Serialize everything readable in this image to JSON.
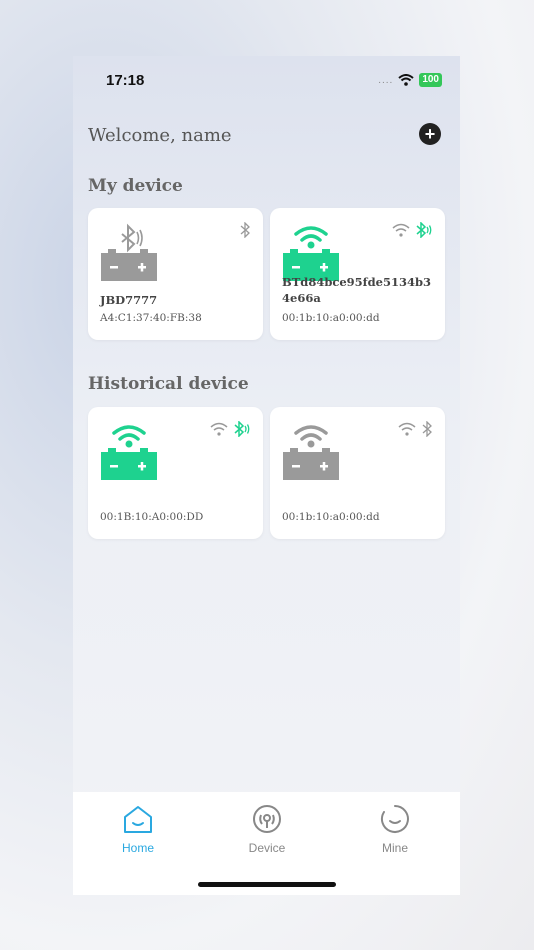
{
  "status_bar": {
    "time": "17:18",
    "signal": "....",
    "battery": "100"
  },
  "header": {
    "welcome": "Welcome, name"
  },
  "sections": {
    "my_device": "My device",
    "historical_device": "Historical device"
  },
  "my_devices": [
    {
      "name": "JBD7777",
      "mac": "A4:C1:37:40:FB:38",
      "battery_color": "#9a9a9a",
      "wifi": false,
      "bluetooth_active": false
    },
    {
      "name": "BTd84bce95fde5134b34e66a",
      "mac": "00:1b:10:a0:00:dd",
      "battery_color": "#1ed28f",
      "wifi": true,
      "bluetooth_active": true
    }
  ],
  "historical_devices": [
    {
      "name": "",
      "mac": "00:1B:10:A0:00:DD",
      "battery_color": "#1ed28f",
      "bluetooth_active": true
    },
    {
      "name": "",
      "mac": "00:1b:10:a0:00:dd",
      "battery_color": "#9a9a9a",
      "bluetooth_active": false
    }
  ],
  "tabs": [
    {
      "label": "Home",
      "icon": "home-icon",
      "active": true
    },
    {
      "label": "Device",
      "icon": "device-signal-icon",
      "active": false
    },
    {
      "label": "Mine",
      "icon": "profile-smile-icon",
      "active": false
    }
  ],
  "colors": {
    "accent": "#2aa8e0",
    "green": "#1ed28f",
    "gray": "#9a9a9a"
  }
}
